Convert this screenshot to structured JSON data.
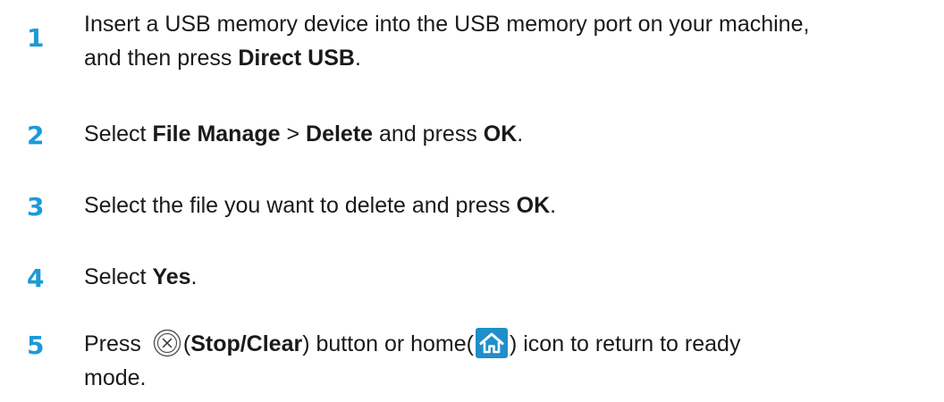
{
  "steps": [
    {
      "number": "1",
      "line1": "Insert a USB memory device into the USB memory port on your machine,",
      "line2_pre": "and then press ",
      "line2_bold": "Direct USB",
      "line2_post": "."
    },
    {
      "number": "2",
      "pre": "Select ",
      "bold1": "File Manage",
      "mid": " > ",
      "bold2": "Delete",
      "mid2": " and press ",
      "bold3": "OK",
      "post": "."
    },
    {
      "number": "3",
      "pre": "Select the file you want to delete and press ",
      "bold": "OK",
      "post": "."
    },
    {
      "number": "4",
      "pre": "Select ",
      "bold": "Yes",
      "post": "."
    },
    {
      "number": "5",
      "pre": "Press ",
      "paren_open": "(",
      "bold": "Stop/Clear",
      "mid": ") button or home(",
      "post": ") icon to return to ready",
      "line2": "mode.",
      "stop_icon": "stop-clear-icon",
      "home_icon": "home-icon",
      "home_icon_bg": "#1e8fc8"
    }
  ],
  "colors": {
    "step_number": "#1b9ad7",
    "text": "#1a1a1a"
  }
}
